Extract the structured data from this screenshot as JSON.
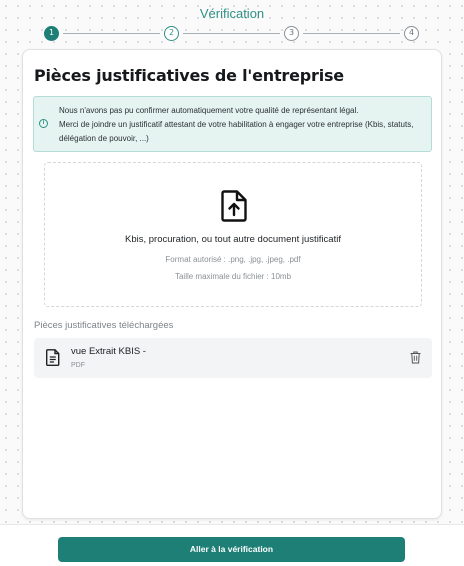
{
  "header": {
    "title": "Vérification"
  },
  "stepper": {
    "steps": [
      "1",
      "2",
      "3",
      "4"
    ],
    "active_index": 0
  },
  "card": {
    "title": "Pièces justificatives de l'entreprise",
    "alert": {
      "line1": "Nous n'avons pas pu confirmer automatiquement votre qualité de représentant légal.",
      "line2": "Merci de joindre un justificatif attestant de votre habilitation à engager votre entreprise (Kbis, statuts, délégation de pouvoir, ...)",
      "icon": "info-icon"
    },
    "dropzone": {
      "label": "Kbis, procuration, ou tout autre document justificatif",
      "formats": "Format autorisé : .png, .jpg, .jpeg, .pdf",
      "max_size": "Taille maximale du fichier : 10mb",
      "icon": "file-upload-icon"
    },
    "uploaded": {
      "label": "Pièces justificatives téléchargées",
      "files": [
        {
          "name": "vue Extrait KBIS -",
          "type": "PDF",
          "icon": "document-icon",
          "action_icon": "trash-icon"
        }
      ]
    }
  },
  "footer": {
    "button_label": "Aller à la vérification"
  },
  "colors": {
    "accent": "#1e7f77",
    "alert_bg": "#e5f3f1"
  }
}
